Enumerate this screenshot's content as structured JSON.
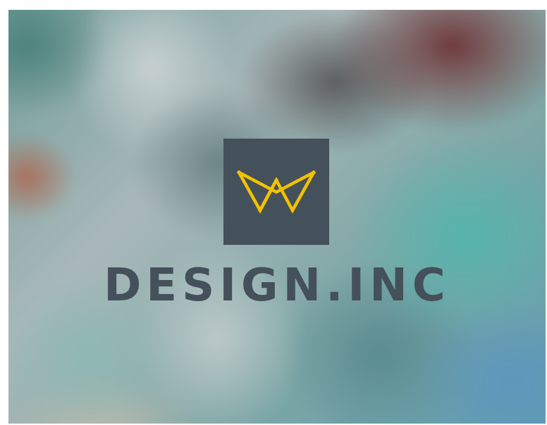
{
  "brand": {
    "name": "DESIGN.INC",
    "logo_icon": "crown-w-icon",
    "logo_color": "#f2c200",
    "box_color": "#44505a",
    "text_color": "#44505a"
  },
  "background": {
    "style": "blurred multicolor gradient"
  }
}
